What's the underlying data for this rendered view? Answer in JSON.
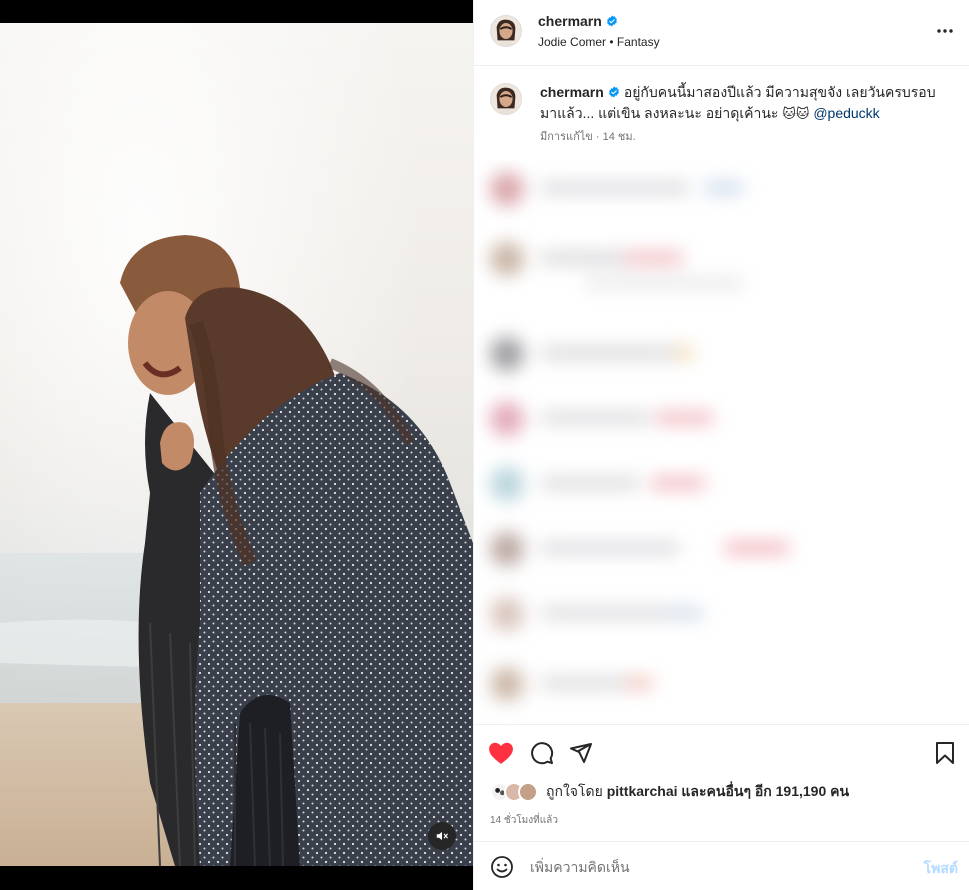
{
  "post": {
    "username": "chermarn",
    "verified": true,
    "audio": "Jodie Comer • Fantasy"
  },
  "caption": {
    "username": "chermarn",
    "text": "อยู่กับคนนี้มาสองปีแล้ว มีความสุขจัง เลยวันครบรอบมาแล้ว... แต่เขิน ลงหละนะ อย่าดุเค้านะ",
    "emojis": "🐱🐱",
    "mention": "@peduckk",
    "meta": "มีการแก้ไข · 14 ชม."
  },
  "likes": {
    "prefix": "ถูกใจโดย",
    "liked_by": "pittkarchai",
    "middle": "และ",
    "others": "คนอื่นๆ อีก 191,190 คน"
  },
  "time_ago": "14 ชั่วโมงที่แล้ว",
  "comment_box": {
    "placeholder": "เพิ่มความคิดเห็น",
    "post_label": "โพสต์"
  },
  "icons": {
    "like": "heart-filled-icon",
    "comment": "comment-icon",
    "share": "share-icon",
    "save": "bookmark-icon",
    "more": "more-options-icon",
    "mute": "speaker-muted-icon",
    "emoji": "emoji-icon",
    "verified": "verified-badge-icon"
  },
  "colors": {
    "like_red": "#ff3040",
    "verified_blue": "#0095f6",
    "link": "#00376b",
    "post_disabled": "#b3dbff"
  }
}
